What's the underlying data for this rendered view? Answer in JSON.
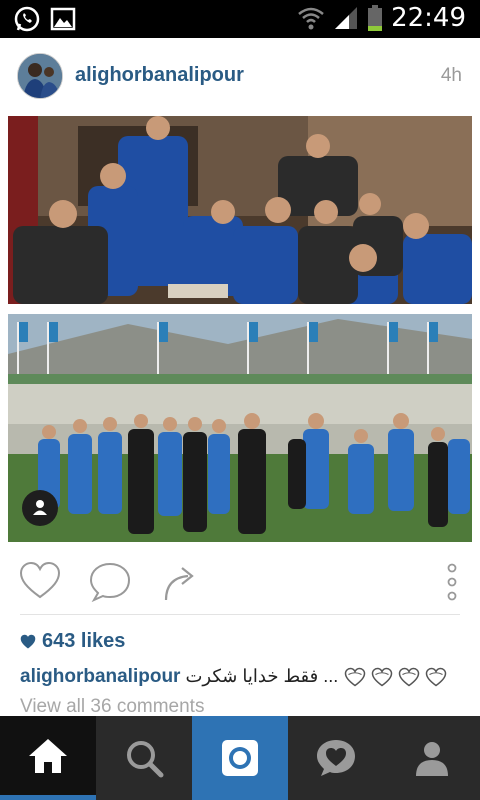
{
  "status_bar": {
    "time": "22:49",
    "icons": [
      "whatsapp-icon",
      "image-icon",
      "wifi-icon",
      "signal-icon",
      "battery-icon"
    ]
  },
  "post": {
    "username": "alighorbanalipour",
    "time_ago": "4h",
    "likes": "643 likes",
    "caption_user": "alighorbanalipour",
    "caption_text": "فقط خدایا شکرت ...",
    "view_comments": "View all 36 comments"
  },
  "colors": {
    "accent": "#2e73b4",
    "username": "#2a5b84",
    "tab_bg": "#2a2a2a"
  },
  "tabs": [
    "home-icon",
    "search-icon",
    "camera-icon",
    "activity-icon",
    "profile-icon"
  ]
}
